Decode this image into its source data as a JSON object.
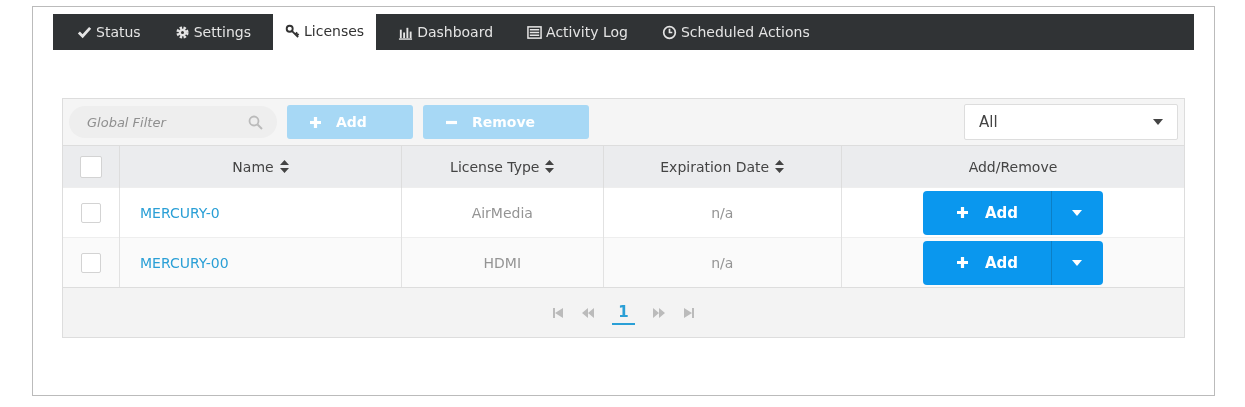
{
  "tabs": [
    {
      "label": "Status",
      "selected": false
    },
    {
      "label": "Settings",
      "selected": false
    },
    {
      "label": "Licenses",
      "selected": true
    },
    {
      "label": "Dashboard",
      "selected": false
    },
    {
      "label": "Activity Log",
      "selected": false
    },
    {
      "label": "Scheduled Actions",
      "selected": false
    }
  ],
  "toolbar": {
    "filter": {
      "placeholder": "Global Filter"
    },
    "buttons": [
      {
        "label": "Add",
        "kind": "add",
        "disabled": true
      },
      {
        "label": "Remove",
        "kind": "remove",
        "disabled": true
      }
    ],
    "dropdown": {
      "value": "All"
    }
  },
  "table": {
    "select_all": {
      "checked": false
    },
    "columns": [
      {
        "label": "Name",
        "sortable": true
      },
      {
        "label": "License Type",
        "sortable": true
      },
      {
        "label": "Expiration Date",
        "sortable": true
      },
      {
        "label": "Add/Remove",
        "sortable": false
      }
    ],
    "rows": [
      {
        "checked": false,
        "name": "MERCURY-0",
        "license_type": "AirMedia",
        "expiration": "n/a",
        "action": "Add"
      },
      {
        "checked": false,
        "name": "MERCURY-00",
        "license_type": "HDMI",
        "expiration": "n/a",
        "action": "Add"
      }
    ]
  },
  "pagination": {
    "pages": [
      {
        "label": "1",
        "selected": true
      }
    ]
  }
}
